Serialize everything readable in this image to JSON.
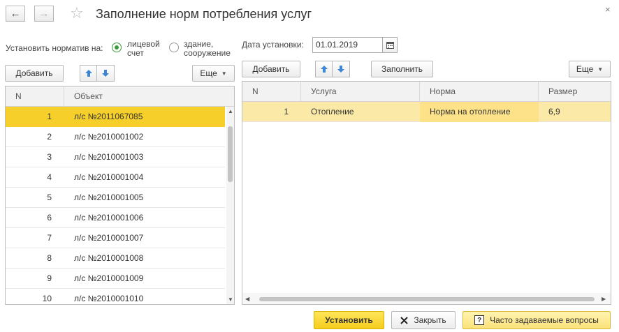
{
  "window": {
    "title": "Заполнение норм потребления услуг",
    "back_icon": "←",
    "forward_icon": "→",
    "star_icon": "☆",
    "close_icon": "×"
  },
  "left": {
    "set_norm_label": "Установить норматив на:",
    "radio_personal_line1": "лицевой",
    "radio_personal_line2": "счет",
    "radio_building_line1": "здание,",
    "radio_building_line2": "сооружение",
    "add_label": "Добавить",
    "more_label": "Еще",
    "columns": [
      "N",
      "Объект"
    ],
    "rows": [
      {
        "n": "1",
        "object": "л/с №2011067085"
      },
      {
        "n": "2",
        "object": "л/с №2010001002"
      },
      {
        "n": "3",
        "object": "л/с №2010001003"
      },
      {
        "n": "4",
        "object": "л/с №2010001004"
      },
      {
        "n": "5",
        "object": "л/с №2010001005"
      },
      {
        "n": "6",
        "object": "л/с №2010001006"
      },
      {
        "n": "7",
        "object": "л/с №2010001007"
      },
      {
        "n": "8",
        "object": "л/с №2010001008"
      },
      {
        "n": "9",
        "object": "л/с №2010001009"
      },
      {
        "n": "10",
        "object": "л/с №2010001010"
      }
    ]
  },
  "right": {
    "date_label": "Дата установки:",
    "date_value": "01.01.2019",
    "add_label": "Добавить",
    "fill_label": "Заполнить",
    "more_label": "Еще",
    "columns": [
      "N",
      "Услуга",
      "Норма",
      "Размер"
    ],
    "rows": [
      {
        "n": "1",
        "service": "Отопление",
        "norm": "Норма на отопление",
        "size": "6,9"
      }
    ]
  },
  "footer": {
    "set_label": "Установить",
    "close_label": "Закрыть",
    "faq_label": "Часто задаваемые вопросы"
  },
  "colors": {
    "selection": "#f6cf2a",
    "selection_row": "#fbe9a7",
    "primary_button": "#f5cc1c",
    "radio_accent": "#3c9a3c"
  }
}
